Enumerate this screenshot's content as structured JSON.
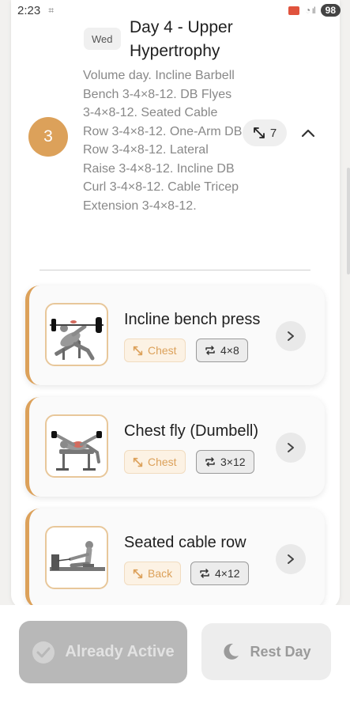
{
  "status_bar": {
    "time": "2:23",
    "battery": "98"
  },
  "day": {
    "number": "3",
    "weekday": "Wed",
    "title": "Day 4 - Upper Hypertrophy",
    "description": "Volume day. Incline Barbell Bench 3-4×8-12. DB Flyes 3-4×8-12. Seated Cable Row 3-4×8-12. One-Arm DB Row 3-4×8-12. Lateral Raise 3-4×8-12. Incline DB Curl 3-4×8-12. Cable Tricep Extension 3-4×8-12.",
    "exercise_count": "7"
  },
  "exercises": [
    {
      "name": "Incline bench press",
      "muscle": "Chest",
      "sets": "4×8"
    },
    {
      "name": "Chest fly (Dumbell)",
      "muscle": "Chest",
      "sets": "3×12"
    },
    {
      "name": "Seated cable row",
      "muscle": "Back",
      "sets": "4×12"
    }
  ],
  "actions": {
    "active_label": "Already Active",
    "rest_label": "Rest Day"
  },
  "colors": {
    "accent": "#dca15a",
    "chip_bg": "#fcf2e4",
    "disabled": "#b8b8b8"
  },
  "icons": {
    "expand": "arrows-expand-icon",
    "collapse": "chevron-up-icon",
    "muscle": "arrows-expand-icon",
    "sets": "repeat-icon",
    "open": "chevron-right-icon",
    "active": "check-circle-icon",
    "rest": "moon-icon"
  }
}
